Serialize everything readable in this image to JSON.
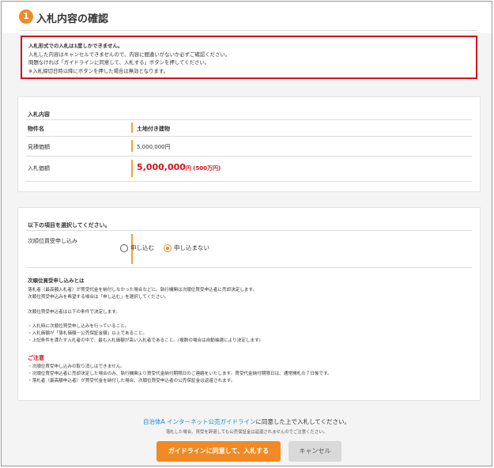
{
  "header": {
    "step_number": "1",
    "title": "入札内容の確認"
  },
  "notice": {
    "lines": [
      "入札形式での入札は1度しかできません。",
      "入札した内容はキャンセルできませんので、内容に間違いがないか必ずご確認ください。",
      "問題なければ「ガイドラインに同意して、入札する」ボタンを押してください。",
      "※入札締切日時以降にボタンを押した場合は無効となります。"
    ]
  },
  "bid_details": {
    "section_title": "入札内容",
    "item_label": "物件名",
    "item_value": "土地付き建物",
    "estimate_label": "見積価額",
    "estimate_value": "5,000,000円",
    "bid_label": "入札価額",
    "bid_value": "5,000,000",
    "bid_unit": "円",
    "bid_sub": "(500万円)"
  },
  "secondary": {
    "section_title": "以下の項目を選択してください。",
    "field_label": "次順位買受申し込み",
    "options": [
      {
        "label": "申し込む",
        "selected": false
      },
      {
        "label": "申し込まない",
        "selected": true
      }
    ],
    "about_title": "次順位買受申し込みとは",
    "about_lines": [
      "落札者（最高額入札者）が買受代金を納付しなかった場合などに、執行機関は次順位買受申込者に売却決定します。",
      "次順位買受申込みを希望する場合は「申し込む」を選択してください。",
      "",
      "次順位買受申込者は以下の条件で決定します。",
      "",
      "・入札時に次順位買受申し込みを行っていること。",
      "・入札価額が「落札価額－公売保証金額」以上であること。",
      "・上記条件を満たす入札者の中で、最も入札価額が高い入札者であること。(複数の場合は自動抽選により決定します)"
    ],
    "caution_title": "ご注意",
    "caution_lines": [
      "・次順位買受申し込みの取り消しはできません。",
      "・次順位買受申込者に売却決定した場合のみ、執行機関より買受代金納付期限日のご連絡をいたします。買受代金納付期限日は、通常開札の７日後です。",
      "・落札者（最高額申込者）が買受代金を納付した場合、次順位買受申込者の公売保証金は返還されます。"
    ]
  },
  "footer": {
    "guideline_link": "自治体A インターネット公売ガイドライン",
    "agree_text": "に同意した上で入札してください。",
    "sub_note": "落札した場合、買受を辞退しても公売保証金は返還されませんのでご注意ください。",
    "agree_button": "ガイドラインに同意して、入札する",
    "cancel_button": "キャンセル"
  },
  "colors": {
    "accent": "#f08a24",
    "alert": "#d6121c",
    "link": "#1e88d6"
  }
}
